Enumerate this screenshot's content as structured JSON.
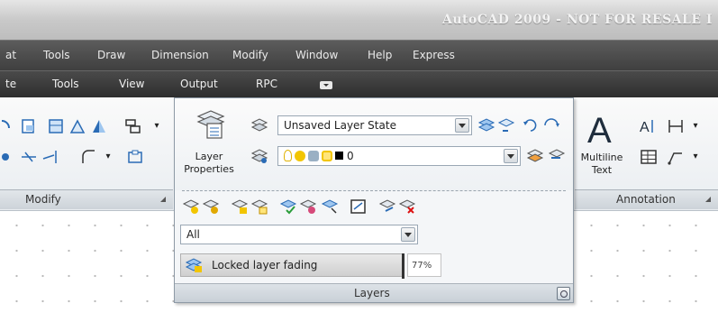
{
  "window": {
    "title": "AutoCAD 2009 - NOT FOR RESALE I"
  },
  "menubar": {
    "items": [
      "at",
      "Tools",
      "Draw",
      "Dimension",
      "Modify",
      "Window",
      "Help",
      "Express"
    ]
  },
  "tabs": {
    "items": [
      "te",
      "Tools",
      "View",
      "Output",
      "RPC"
    ]
  },
  "panels": {
    "modify": {
      "title": "Modify"
    },
    "annotation": {
      "title": "Annotation",
      "multiline_text_line1": "Multiline",
      "multiline_text_line2": "Text",
      "text_glyph": "A"
    }
  },
  "layers": {
    "title": "Layers",
    "properties_label_line1": "Layer",
    "properties_label_line2": "Properties",
    "layer_state": "Unsaved Layer State",
    "current_layer": "0",
    "filter": "All",
    "locked_fading_label": "Locked layer fading",
    "locked_fading_percent": "77%",
    "locked_fading_value": 0.77
  },
  "colors": {
    "menubar": "#3f3f3f",
    "ribbon": "#e9edf1",
    "panel_border": "#8e9aa6",
    "accent_yellow": "#f2c500"
  }
}
